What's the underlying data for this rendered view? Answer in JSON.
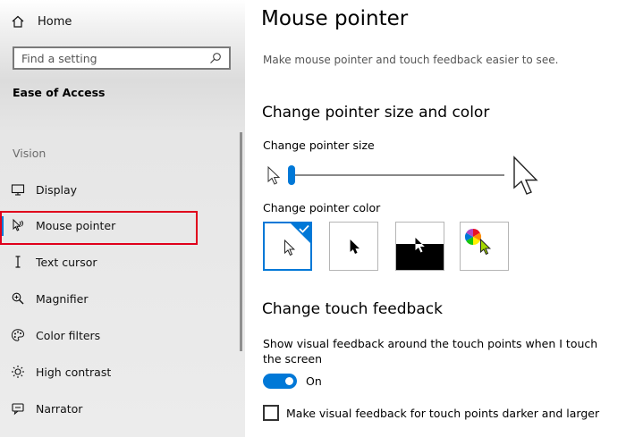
{
  "sidebar": {
    "home_label": "Home",
    "search_placeholder": "Find a setting",
    "section_title": "Ease of Access",
    "group_label": "Vision",
    "items": [
      {
        "label": "Display",
        "icon": "display-icon"
      },
      {
        "label": "Mouse pointer",
        "icon": "mouse-pointer-icon",
        "selected": true
      },
      {
        "label": "Text cursor",
        "icon": "text-cursor-icon"
      },
      {
        "label": "Magnifier",
        "icon": "magnifier-icon"
      },
      {
        "label": "Color filters",
        "icon": "color-filters-icon"
      },
      {
        "label": "High contrast",
        "icon": "high-contrast-icon"
      },
      {
        "label": "Narrator",
        "icon": "narrator-icon"
      }
    ]
  },
  "main": {
    "title": "Mouse pointer",
    "subtitle": "Make mouse pointer and touch feedback easier to see.",
    "pointer_section": {
      "heading": "Change pointer size and color",
      "size_label": "Change pointer size",
      "size_value": 1,
      "color_label": "Change pointer color",
      "color_options": [
        "white",
        "black",
        "inverted",
        "custom"
      ],
      "selected_color": "white"
    },
    "touch_section": {
      "heading": "Change touch feedback",
      "show_feedback_label": "Show visual feedback around the touch points when I touch the screen",
      "toggle_state": "On",
      "darker_label": "Make visual feedback for touch points darker and larger",
      "darker_checked": false
    }
  },
  "colors": {
    "accent": "#0078d7",
    "highlight_border": "#e0001b"
  }
}
